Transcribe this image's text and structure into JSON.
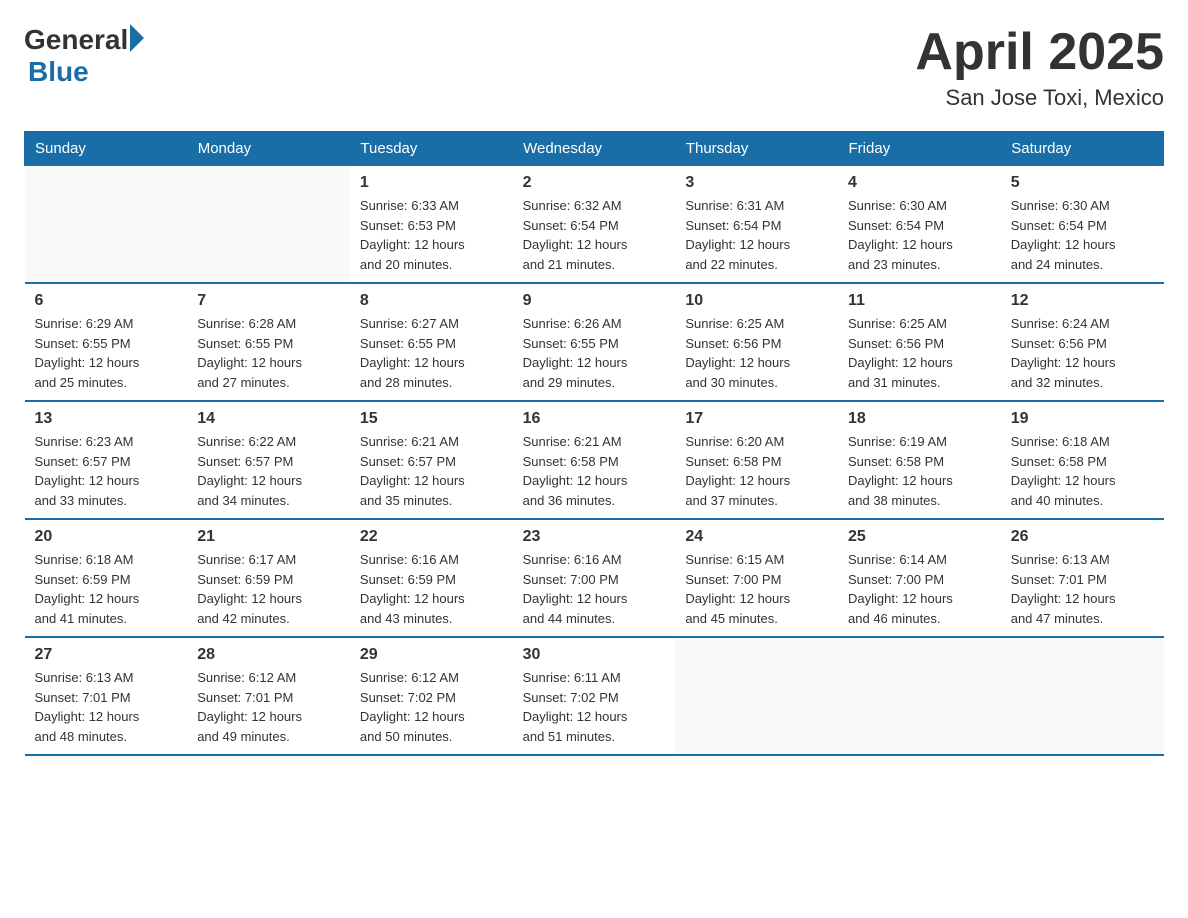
{
  "header": {
    "logo_general": "General",
    "logo_blue": "Blue",
    "title": "April 2025",
    "subtitle": "San Jose Toxi, Mexico"
  },
  "calendar": {
    "days_of_week": [
      "Sunday",
      "Monday",
      "Tuesday",
      "Wednesday",
      "Thursday",
      "Friday",
      "Saturday"
    ],
    "weeks": [
      [
        {
          "day": "",
          "info": ""
        },
        {
          "day": "",
          "info": ""
        },
        {
          "day": "1",
          "info": "Sunrise: 6:33 AM\nSunset: 6:53 PM\nDaylight: 12 hours\nand 20 minutes."
        },
        {
          "day": "2",
          "info": "Sunrise: 6:32 AM\nSunset: 6:54 PM\nDaylight: 12 hours\nand 21 minutes."
        },
        {
          "day": "3",
          "info": "Sunrise: 6:31 AM\nSunset: 6:54 PM\nDaylight: 12 hours\nand 22 minutes."
        },
        {
          "day": "4",
          "info": "Sunrise: 6:30 AM\nSunset: 6:54 PM\nDaylight: 12 hours\nand 23 minutes."
        },
        {
          "day": "5",
          "info": "Sunrise: 6:30 AM\nSunset: 6:54 PM\nDaylight: 12 hours\nand 24 minutes."
        }
      ],
      [
        {
          "day": "6",
          "info": "Sunrise: 6:29 AM\nSunset: 6:55 PM\nDaylight: 12 hours\nand 25 minutes."
        },
        {
          "day": "7",
          "info": "Sunrise: 6:28 AM\nSunset: 6:55 PM\nDaylight: 12 hours\nand 27 minutes."
        },
        {
          "day": "8",
          "info": "Sunrise: 6:27 AM\nSunset: 6:55 PM\nDaylight: 12 hours\nand 28 minutes."
        },
        {
          "day": "9",
          "info": "Sunrise: 6:26 AM\nSunset: 6:55 PM\nDaylight: 12 hours\nand 29 minutes."
        },
        {
          "day": "10",
          "info": "Sunrise: 6:25 AM\nSunset: 6:56 PM\nDaylight: 12 hours\nand 30 minutes."
        },
        {
          "day": "11",
          "info": "Sunrise: 6:25 AM\nSunset: 6:56 PM\nDaylight: 12 hours\nand 31 minutes."
        },
        {
          "day": "12",
          "info": "Sunrise: 6:24 AM\nSunset: 6:56 PM\nDaylight: 12 hours\nand 32 minutes."
        }
      ],
      [
        {
          "day": "13",
          "info": "Sunrise: 6:23 AM\nSunset: 6:57 PM\nDaylight: 12 hours\nand 33 minutes."
        },
        {
          "day": "14",
          "info": "Sunrise: 6:22 AM\nSunset: 6:57 PM\nDaylight: 12 hours\nand 34 minutes."
        },
        {
          "day": "15",
          "info": "Sunrise: 6:21 AM\nSunset: 6:57 PM\nDaylight: 12 hours\nand 35 minutes."
        },
        {
          "day": "16",
          "info": "Sunrise: 6:21 AM\nSunset: 6:58 PM\nDaylight: 12 hours\nand 36 minutes."
        },
        {
          "day": "17",
          "info": "Sunrise: 6:20 AM\nSunset: 6:58 PM\nDaylight: 12 hours\nand 37 minutes."
        },
        {
          "day": "18",
          "info": "Sunrise: 6:19 AM\nSunset: 6:58 PM\nDaylight: 12 hours\nand 38 minutes."
        },
        {
          "day": "19",
          "info": "Sunrise: 6:18 AM\nSunset: 6:58 PM\nDaylight: 12 hours\nand 40 minutes."
        }
      ],
      [
        {
          "day": "20",
          "info": "Sunrise: 6:18 AM\nSunset: 6:59 PM\nDaylight: 12 hours\nand 41 minutes."
        },
        {
          "day": "21",
          "info": "Sunrise: 6:17 AM\nSunset: 6:59 PM\nDaylight: 12 hours\nand 42 minutes."
        },
        {
          "day": "22",
          "info": "Sunrise: 6:16 AM\nSunset: 6:59 PM\nDaylight: 12 hours\nand 43 minutes."
        },
        {
          "day": "23",
          "info": "Sunrise: 6:16 AM\nSunset: 7:00 PM\nDaylight: 12 hours\nand 44 minutes."
        },
        {
          "day": "24",
          "info": "Sunrise: 6:15 AM\nSunset: 7:00 PM\nDaylight: 12 hours\nand 45 minutes."
        },
        {
          "day": "25",
          "info": "Sunrise: 6:14 AM\nSunset: 7:00 PM\nDaylight: 12 hours\nand 46 minutes."
        },
        {
          "day": "26",
          "info": "Sunrise: 6:13 AM\nSunset: 7:01 PM\nDaylight: 12 hours\nand 47 minutes."
        }
      ],
      [
        {
          "day": "27",
          "info": "Sunrise: 6:13 AM\nSunset: 7:01 PM\nDaylight: 12 hours\nand 48 minutes."
        },
        {
          "day": "28",
          "info": "Sunrise: 6:12 AM\nSunset: 7:01 PM\nDaylight: 12 hours\nand 49 minutes."
        },
        {
          "day": "29",
          "info": "Sunrise: 6:12 AM\nSunset: 7:02 PM\nDaylight: 12 hours\nand 50 minutes."
        },
        {
          "day": "30",
          "info": "Sunrise: 6:11 AM\nSunset: 7:02 PM\nDaylight: 12 hours\nand 51 minutes."
        },
        {
          "day": "",
          "info": ""
        },
        {
          "day": "",
          "info": ""
        },
        {
          "day": "",
          "info": ""
        }
      ]
    ]
  }
}
